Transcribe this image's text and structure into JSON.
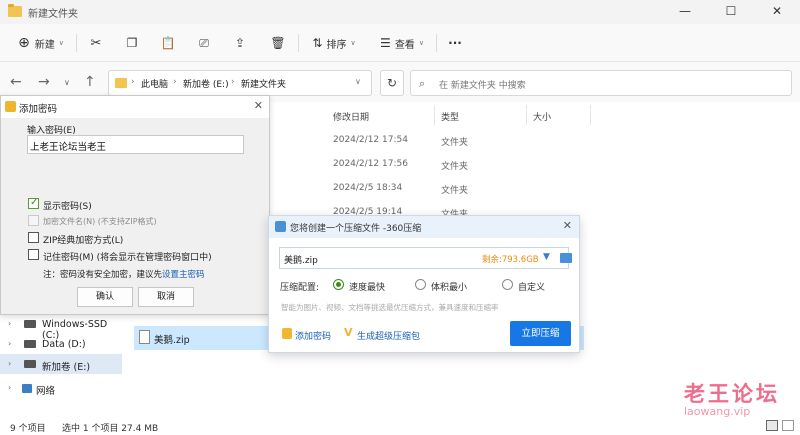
{
  "window": {
    "title": "新建文件夹"
  },
  "toolbar": {
    "new_label": "新建",
    "sort_label": "排序",
    "view_label": "查看",
    "more_label": "···"
  },
  "address": {
    "segments": [
      "此电脑",
      "新加卷 (E:)",
      "新建文件夹"
    ],
    "search_placeholder": "在 新建文件夹 中搜索"
  },
  "columns": {
    "modified": "修改日期",
    "type": "类型",
    "size": "大小"
  },
  "rows": [
    {
      "date": "2024/2/12 17:54",
      "type": "文件夹"
    },
    {
      "date": "2024/2/12 17:56",
      "type": "文件夹"
    },
    {
      "date": "2024/2/5 18:34",
      "type": "文件夹"
    },
    {
      "date": "2024/2/5 19:14",
      "type": "文件夹"
    }
  ],
  "sidebar": {
    "items": [
      "Windows-SSD (C:)",
      "Data (D:)",
      "新加卷 (E:)",
      "网络"
    ]
  },
  "selected_file": "美鹅.zip",
  "status": {
    "count": "9 个项目",
    "selection": "选中 1 个项目 27.4 MB"
  },
  "password_dialog": {
    "title": "添加密码",
    "input_label": "输入密码(E)",
    "password_value": "上老王论坛当老王",
    "show_password": "显示密码(S)",
    "encrypt_names": "加密文件名(N) (不支持ZIP格式)",
    "zip_classic": "ZIP经典加密方式(L)",
    "remember": "记住密码(M) (将会显示在管理密码窗口中)",
    "note": "注：密码没有安全加密，建议先",
    "note_link": "设置主密码",
    "ok": "确认",
    "cancel": "取消"
  },
  "zip_dialog": {
    "title": "您将创建一个压缩文件 -360压缩",
    "file_name": "美鹅.zip",
    "free_space": "剩余:793.6GB",
    "config_label": "压缩配置:",
    "option_fast": "速度最快",
    "option_small": "体积最小",
    "option_custom": "自定义",
    "hint": "智能为图片、视频、文档等挑选最优压缩方式，兼具速度和压缩率",
    "add_password": "添加密码",
    "super_pack": "生成超级压缩包",
    "compress_now": "立即压缩"
  },
  "watermark": {
    "name": "老王论坛",
    "site": "laowang.vip"
  }
}
